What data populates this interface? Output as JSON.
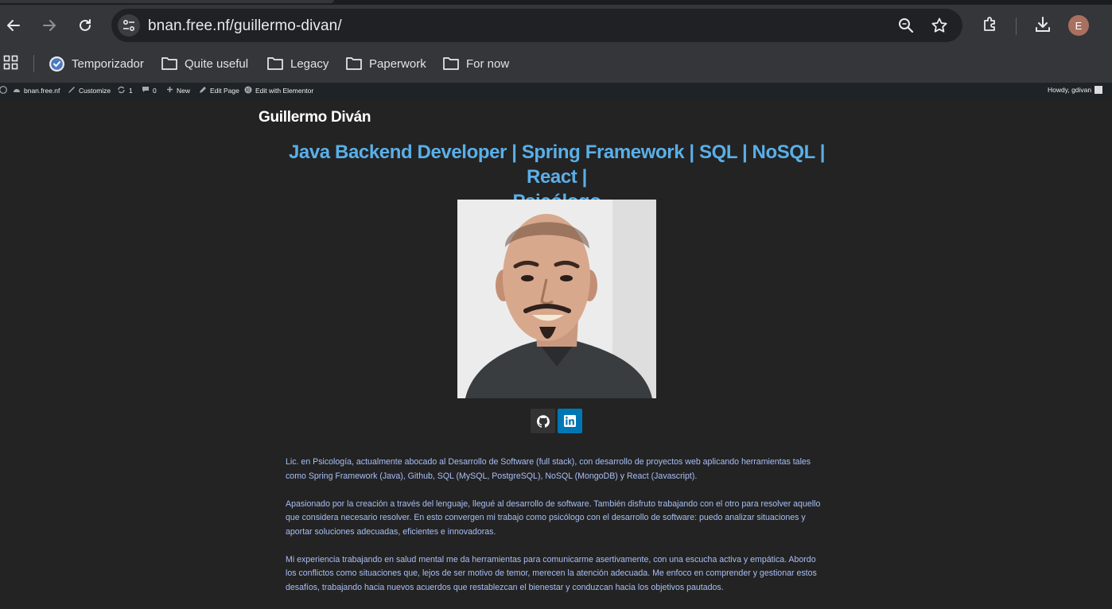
{
  "browser": {
    "url": "bnan.free.nf/guillermo-divan/",
    "avatar_initial": "E",
    "bookmarks": [
      {
        "label": "Temporizador",
        "icon": "clock-check-icon"
      },
      {
        "label": "Quite useful",
        "icon": "folder-icon"
      },
      {
        "label": "Legacy",
        "icon": "folder-icon"
      },
      {
        "label": "Paperwork",
        "icon": "folder-icon"
      },
      {
        "label": "For now",
        "icon": "folder-icon"
      }
    ]
  },
  "adminbar": {
    "site": "bnan.free.nf",
    "customize": "Customize",
    "updates_count": "1",
    "comments_count": "0",
    "new": "New",
    "edit_page": "Edit Page",
    "elementor": "Edit with Elementor",
    "howdy": "Howdy, gdivan"
  },
  "page": {
    "site_title": "Guillermo Diván",
    "headline_line1": "Java Backend Developer | Spring Framework | SQL | NoSQL | React |",
    "headline_line2": "Psicólogo",
    "social": [
      {
        "name": "github",
        "icon": "github-icon",
        "bg": "#333333"
      },
      {
        "name": "linkedin",
        "icon": "linkedin-icon",
        "bg": "#0077b5"
      }
    ],
    "bio": [
      "Lic. en Psicología, actualmente abocado al Desarrollo de Software (full stack), con desarrollo de proyectos web aplicando herramientas tales como Spring Framework (Java), Github, SQL (MySQL, PostgreSQL), NoSQL (MongoDB) y React (Javascript).",
      "Apasionado por la creación a través del lenguaje, llegué al desarrollo de software. También disfruto trabajando con el otro para resolver aquello que considera necesario resolver. En esto convergen mi trabajo como psicólogo con el desarrollo de software: puedo analizar situaciones y aportar soluciones adecuadas, eficientes e innovadoras.",
      "Mi experiencia trabajando en salud mental me da herramientas para comunicarme asertivamente, con una escucha activa y empática. Abordo los conflictos como situaciones que, lejos de ser motivo de temor, merecen la atención adecuada. Me enfoco en comprender y gestionar estos desafíos, trabajando hacia nuevos acuerdos que restablezcan el bienestar y conduzcan hacia los objetivos pautados."
    ]
  },
  "colors": {
    "page_bg": "#232323",
    "headline": "#5aafe8",
    "bio_text": "#a8bff6",
    "chrome": "#35363a",
    "adminbar": "#1d2327"
  }
}
